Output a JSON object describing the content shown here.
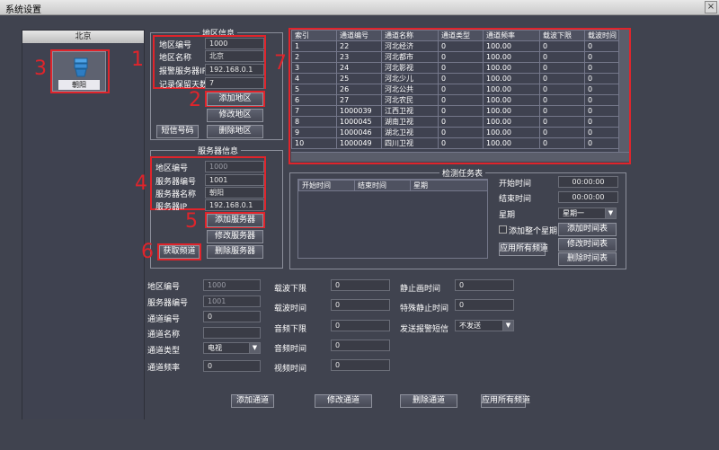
{
  "window": {
    "title": "系统设置",
    "close": "×"
  },
  "left_panel": {
    "header": "北京",
    "tile_label": "朝阳"
  },
  "annotations": [
    "1",
    "2",
    "3",
    "4",
    "5",
    "6",
    "7"
  ],
  "region": {
    "title": "地区信息",
    "code_label": "地区编号",
    "code_value": "1000",
    "name_label": "地区名称",
    "name_value": "北京",
    "ip_label": "报警服务器IP",
    "ip_value": "192.168.0.1",
    "days_label": "记录保留天数",
    "days_value": "7",
    "sms_btn": "短信号码",
    "add_btn": "添加地区",
    "edit_btn": "修改地区",
    "del_btn": "删除地区"
  },
  "server": {
    "title": "服务器信息",
    "area_label": "地区编号",
    "area_value": "1000",
    "code_label": "服务器编号",
    "code_value": "1001",
    "name_label": "服务器名称",
    "name_value": "朝阳",
    "ip_label": "服务器IP",
    "ip_value": "192.168.0.1",
    "fetch_btn": "获取频道",
    "add_btn": "添加服务器",
    "edit_btn": "修改服务器",
    "del_btn": "删除服务器"
  },
  "channel_table": {
    "headers": [
      "索引",
      "通道编号",
      "通道名称",
      "通道类型",
      "通道频率",
      "载波下限",
      "载波时间"
    ],
    "rows": [
      [
        "1",
        "22",
        "河北经济",
        "0",
        "100.00",
        "0",
        "0"
      ],
      [
        "2",
        "23",
        "河北都市",
        "0",
        "100.00",
        "0",
        "0"
      ],
      [
        "3",
        "24",
        "河北影视",
        "0",
        "100.00",
        "0",
        "0"
      ],
      [
        "4",
        "25",
        "河北少儿",
        "0",
        "100.00",
        "0",
        "0"
      ],
      [
        "5",
        "26",
        "河北公共",
        "0",
        "100.00",
        "0",
        "0"
      ],
      [
        "6",
        "27",
        "河北农民",
        "0",
        "100.00",
        "0",
        "0"
      ],
      [
        "7",
        "1000039",
        "江西卫视",
        "0",
        "100.00",
        "0",
        "0"
      ],
      [
        "8",
        "1000045",
        "湖南卫视",
        "0",
        "100.00",
        "0",
        "0"
      ],
      [
        "9",
        "1000046",
        "湖北卫视",
        "0",
        "100.00",
        "0",
        "0"
      ],
      [
        "10",
        "1000049",
        "四川卫视",
        "0",
        "100.00",
        "0",
        "0"
      ]
    ]
  },
  "schedule": {
    "title": "检测任务表",
    "headers": [
      "开始时间",
      "结束时间",
      "星期"
    ],
    "start_label": "开始时间",
    "start_value": "00:00:00",
    "end_label": "结束时间",
    "end_value": "00:00:00",
    "week_label": "星期",
    "week_value": "星期一",
    "all_week_label": "添加整个星期",
    "apply_all_btn": "应用所有频道",
    "add_btn": "添加时间表",
    "edit_btn": "修改时间表",
    "del_btn": "删除时间表"
  },
  "channel_form": {
    "area_label": "地区编号",
    "area_value": "1000",
    "server_label": "服务器编号",
    "server_value": "1001",
    "chan_no_label": "通道编号",
    "chan_no_value": "0",
    "chan_name_label": "通道名称",
    "chan_name_value": "",
    "chan_type_label": "通道类型",
    "chan_type_value": "电视",
    "freq_label": "通道频率",
    "freq_value": "0",
    "carrier_low_label": "载波下限",
    "carrier_low_value": "0",
    "carrier_time_label": "载波时间",
    "carrier_time_value": "0",
    "audio_low_label": "音频下限",
    "audio_low_value": "0",
    "audio_time_label": "音频时间",
    "audio_time_value": "0",
    "video_time_label": "视频时间",
    "video_time_value": "0",
    "still_time_label": "静止画时间",
    "still_time_value": "0",
    "special_still_label": "特殊静止时间",
    "special_still_value": "0",
    "sms_label": "发送报警短信",
    "sms_value": "不发送"
  },
  "bottom": {
    "add": "添加通道",
    "edit": "修改通道",
    "del": "删除通道",
    "apply": "应用所有频道"
  }
}
